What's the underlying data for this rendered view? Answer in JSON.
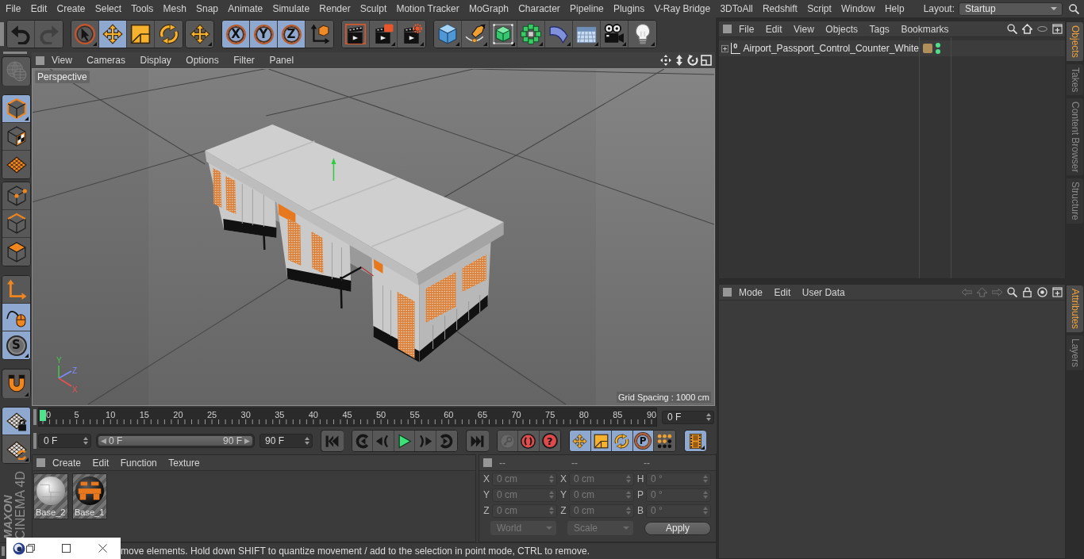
{
  "menu_bar": {
    "items": [
      "File",
      "Edit",
      "Create",
      "Select",
      "Tools",
      "Mesh",
      "Snap",
      "Animate",
      "Simulate",
      "Render",
      "Sculpt",
      "Motion Tracker",
      "MoGraph",
      "Character",
      "Pipeline",
      "Plugins",
      "V-Ray Bridge",
      "3DToAll",
      "Redshift",
      "Script",
      "Window",
      "Help"
    ],
    "layout_label": "Layout:",
    "layout": "Startup"
  },
  "toolbar": {
    "groups": [
      {
        "buttons": [
          {
            "kind": "undo",
            "selected": false,
            "disabled": false
          },
          {
            "kind": "redo",
            "selected": false,
            "disabled": true
          }
        ]
      },
      {
        "buttons": [
          {
            "kind": "select",
            "selected": false,
            "disabled": false
          },
          {
            "kind": "move",
            "selected": true,
            "disabled": false
          },
          {
            "kind": "scale",
            "selected": false,
            "disabled": false
          },
          {
            "kind": "rotate",
            "selected": false,
            "disabled": false
          }
        ]
      },
      {
        "buttons": [
          {
            "kind": "transform",
            "selected": false,
            "disabled": false
          }
        ]
      },
      {
        "buttons": [
          {
            "kind": "axis",
            "label": "X",
            "selected": true,
            "disabled": false
          },
          {
            "kind": "axis",
            "label": "Y",
            "selected": true,
            "disabled": false
          },
          {
            "kind": "axis",
            "label": "Z",
            "selected": true,
            "disabled": false
          },
          {
            "kind": "coords",
            "selected": false,
            "disabled": false
          }
        ]
      },
      {
        "buttons": [
          {
            "kind": "render_view",
            "selected": false,
            "disabled": false
          },
          {
            "kind": "render_picture",
            "selected": false,
            "disabled": false
          },
          {
            "kind": "render_settings",
            "selected": false,
            "disabled": false
          }
        ]
      },
      {
        "buttons": [
          {
            "kind": "cube",
            "selected": false,
            "disabled": false
          },
          {
            "kind": "pen",
            "selected": false,
            "disabled": false
          },
          {
            "kind": "subdivide",
            "selected": false,
            "disabled": false
          },
          {
            "kind": "cloner",
            "selected": false,
            "disabled": false
          },
          {
            "kind": "deformer",
            "selected": false,
            "disabled": false
          },
          {
            "kind": "floor",
            "selected": false,
            "disabled": false
          },
          {
            "kind": "camera",
            "selected": false,
            "disabled": false
          },
          {
            "kind": "light",
            "selected": false,
            "disabled": false
          }
        ]
      }
    ]
  },
  "tool_palette": {
    "groups": [
      {
        "buttons": [
          {
            "kind": "globe",
            "selected": false,
            "disabled": true
          }
        ]
      },
      {
        "buttons": [
          {
            "kind": "model",
            "selected": true,
            "disabled": false
          },
          {
            "kind": "texture",
            "selected": false,
            "disabled": false
          },
          {
            "kind": "workplane",
            "selected": false,
            "disabled": false
          }
        ]
      },
      {
        "buttons": [
          {
            "kind": "points",
            "selected": false,
            "disabled": false
          },
          {
            "kind": "edges",
            "selected": false,
            "disabled": false
          },
          {
            "kind": "polygons",
            "selected": false,
            "disabled": false
          }
        ]
      },
      {
        "buttons": [
          {
            "kind": "axis_tool",
            "selected": false,
            "disabled": false
          },
          {
            "kind": "tweak",
            "selected": true,
            "disabled": false
          },
          {
            "kind": "solo",
            "label": "S",
            "selected": true,
            "disabled": false
          }
        ]
      },
      {
        "buttons": [
          {
            "kind": "magnet",
            "selected": false,
            "disabled": false
          }
        ]
      },
      {
        "buttons": [
          {
            "kind": "grid_lock",
            "selected": true,
            "disabled": false
          },
          {
            "kind": "grid_rotate",
            "selected": false,
            "disabled": false
          }
        ]
      }
    ]
  },
  "logo": [
    "MAXON",
    "CINEMA 4D"
  ],
  "viewport": {
    "menu": [
      "View",
      "Cameras",
      "Display",
      "Options",
      "Filter",
      "Panel"
    ],
    "camera": "Perspective",
    "grid_spacing": "Grid Spacing : 1000 cm",
    "axis_labels": [
      "Y",
      "Z",
      "X"
    ]
  },
  "timeline": {
    "labels": [
      "0",
      "5",
      "10",
      "15",
      "20",
      "25",
      "30",
      "35",
      "40",
      "45",
      "50",
      "55",
      "60",
      "65",
      "70",
      "75",
      "80",
      "85",
      "90"
    ],
    "level": 0,
    "frame": "0 F"
  },
  "playback": {
    "start": "0 F",
    "range": {
      "start": "0 F",
      "end": "90 F",
      "level": 1
    },
    "end": "90 F",
    "groups": [
      {
        "buttons": [
          {
            "kind": "first",
            "selected": false,
            "disabled": false
          }
        ]
      },
      {
        "buttons": [
          {
            "kind": "prev_key",
            "selected": false,
            "disabled": false
          },
          {
            "kind": "prev_frame",
            "selected": false,
            "disabled": false
          },
          {
            "kind": "play",
            "selected": false,
            "disabled": false
          },
          {
            "kind": "next_frame",
            "selected": false,
            "disabled": false
          },
          {
            "kind": "next_key",
            "selected": false,
            "disabled": false
          }
        ]
      },
      {
        "buttons": [
          {
            "kind": "last",
            "selected": false,
            "disabled": false
          }
        ]
      },
      {
        "buttons": [
          {
            "kind": "record",
            "selected": false,
            "disabled": true
          },
          {
            "kind": "autokey",
            "selected": false,
            "disabled": false
          },
          {
            "kind": "keyframe",
            "label": "?",
            "selected": false,
            "disabled": false
          }
        ]
      },
      {
        "buttons": [
          {
            "kind": "move",
            "selected": true,
            "disabled": false
          },
          {
            "kind": "scale",
            "selected": true,
            "disabled": false
          },
          {
            "kind": "rotate",
            "selected": true,
            "disabled": false
          },
          {
            "kind": "param",
            "label": "P",
            "selected": true,
            "disabled": false
          },
          {
            "kind": "pla",
            "selected": false,
            "disabled": false
          }
        ]
      },
      {
        "buttons": [
          {
            "kind": "film",
            "selected": true,
            "disabled": false
          }
        ]
      }
    ]
  },
  "materials": {
    "menu": [
      "Create",
      "Edit",
      "Function",
      "Texture"
    ],
    "items": [
      {
        "name": "Base_2",
        "kind": "white"
      },
      {
        "name": "Base_1",
        "kind": "orange"
      }
    ]
  },
  "coordinates": {
    "disabled": true,
    "headers": [
      "--",
      "--",
      "--"
    ],
    "rows": [
      {
        "axis": "X",
        "position": "0 cm",
        "size_axis": "X",
        "size": "0 cm",
        "rotation_axis": "H",
        "rotation": "0 °"
      },
      {
        "axis": "Y",
        "position": "0 cm",
        "size_axis": "Y",
        "size": "0 cm",
        "rotation_axis": "P",
        "rotation": "0 °"
      },
      {
        "axis": "Z",
        "position": "0 cm",
        "size_axis": "Z",
        "size": "0 cm",
        "rotation_axis": "B",
        "rotation": "0 °"
      }
    ],
    "dropdowns": [
      "World",
      "Scale"
    ],
    "apply": "Apply"
  },
  "status": "move elements. Hold down SHIFT to quantize movement / add to the selection in point mode, CTRL to remove.",
  "object_manager": {
    "menu": [
      "File",
      "Edit",
      "View",
      "Objects",
      "Tags",
      "Bookmarks"
    ],
    "objects": [
      {
        "name": "Airport_Passport_Control_Counter_White",
        "icon_text": "0",
        "expanded": false,
        "editor_visible": true,
        "render_visible": true,
        "tags": [
          {
            "kind": "material"
          }
        ]
      }
    ]
  },
  "object_tabs": [
    {
      "label": "Objects",
      "selected": true
    },
    {
      "label": "Takes",
      "selected": false
    },
    {
      "label": "Content Browser",
      "selected": false
    },
    {
      "label": "Structure",
      "selected": false
    }
  ],
  "attribute_manager": {
    "menu": [
      "Mode",
      "Edit",
      "User Data"
    ]
  },
  "attribute_tabs": [
    {
      "label": "Attributes",
      "selected": true
    },
    {
      "label": "Layers",
      "selected": false
    }
  ]
}
